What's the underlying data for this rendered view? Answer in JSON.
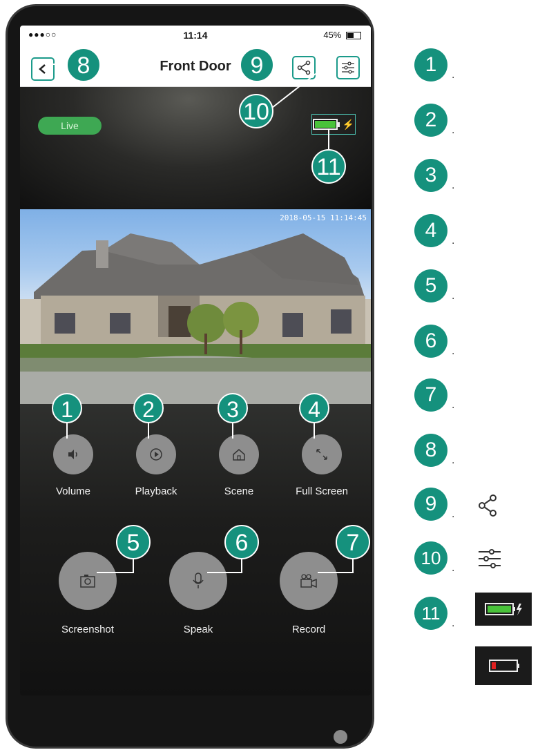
{
  "status_bar": {
    "signal": "●●●○○",
    "time": "11:14",
    "battery_text": "45%"
  },
  "nav": {
    "title": "Front Door"
  },
  "stream": {
    "live_label": "Live",
    "timestamp": "2018-05-15 11:14:45"
  },
  "controls_row1": [
    {
      "label": "Volume",
      "icon": "volume-icon",
      "badge": "1"
    },
    {
      "label": "Playback",
      "icon": "play-icon",
      "badge": "2"
    },
    {
      "label": "Scene",
      "icon": "home-icon",
      "badge": "3"
    },
    {
      "label": "Full Screen",
      "icon": "expand-icon",
      "badge": "4"
    }
  ],
  "controls_row2": [
    {
      "label": "Screenshot",
      "icon": "camera-icon",
      "badge": "5"
    },
    {
      "label": "Speak",
      "icon": "microphone-icon",
      "badge": "6"
    },
    {
      "label": "Record",
      "icon": "video-camera-icon",
      "badge": "7"
    }
  ],
  "callouts": {
    "back": "8",
    "share": "9",
    "settings": "10",
    "battery": "11"
  },
  "legend": [
    {
      "num": "1",
      "dot": "."
    },
    {
      "num": "2",
      "dot": "."
    },
    {
      "num": "3",
      "dot": "."
    },
    {
      "num": "4",
      "dot": "."
    },
    {
      "num": "5",
      "dot": "."
    },
    {
      "num": "6",
      "dot": "."
    },
    {
      "num": "7",
      "dot": "."
    },
    {
      "num": "8",
      "dot": "."
    },
    {
      "num": "9",
      "dot": ".",
      "icon": "share-icon"
    },
    {
      "num": "10",
      "dot": ".",
      "icon": "settings-sliders-icon"
    },
    {
      "num": "11",
      "dot": ".",
      "icon": "battery-charging-icon"
    }
  ],
  "colors": {
    "accent": "#15917d",
    "live": "#3ea853",
    "battery_full": "#49c23a",
    "battery_low": "#e02020"
  }
}
